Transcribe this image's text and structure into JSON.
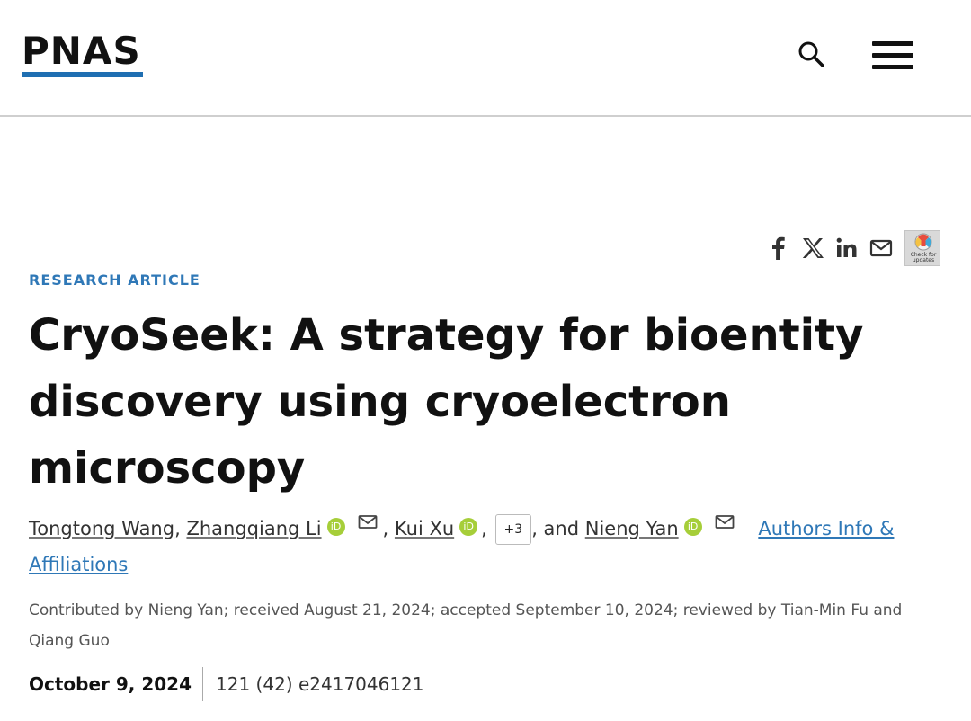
{
  "header": {
    "logo": "PNAS",
    "brand_color": "#1f6fb2",
    "search_icon": "search-icon",
    "menu_icon": "hamburger-menu-icon"
  },
  "share": {
    "icons": [
      "facebook-icon",
      "x-icon",
      "linkedin-icon",
      "email-icon"
    ],
    "crossmark_label": "Check for updates"
  },
  "article": {
    "category": "RESEARCH ARTICLE",
    "category_color": "#2f78b7",
    "title": "CryoSeek: A strategy for bioentity discovery using cryoelectron microscopy",
    "authors": [
      {
        "name": "Tongtong Wang",
        "orcid": false,
        "email": false
      },
      {
        "name": "Zhangqiang Li",
        "orcid": true,
        "email": true
      },
      {
        "name": "Kui Xu",
        "orcid": true,
        "email": false
      },
      {
        "name": "Nieng Yan",
        "orcid": true,
        "email": true
      }
    ],
    "sep_comma": ",",
    "and_text": ", and",
    "more_authors": "+3",
    "orcid_label": "iD",
    "authors_info_link": "Authors Info & Affiliations",
    "history": "Contributed by Nieng Yan; received August 21, 2024; accepted September 10, 2024; reviewed by Tian-Min Fu and Qiang Guo",
    "pub_date": "October 9, 2024",
    "volume_info": "121 (42) e2417046121"
  }
}
